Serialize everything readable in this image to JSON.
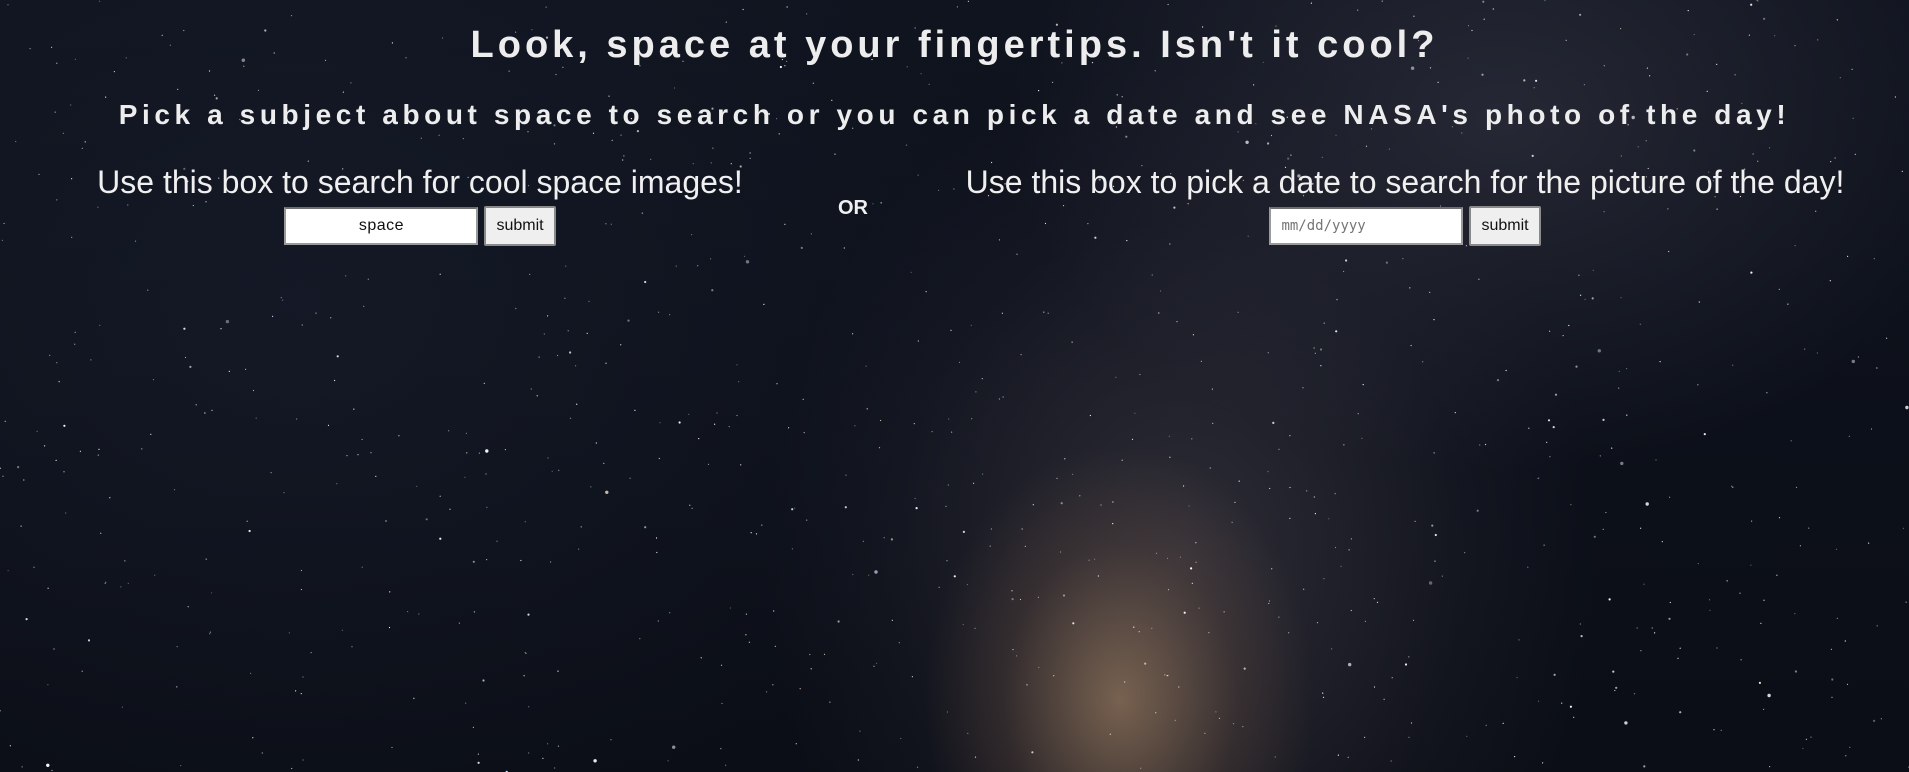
{
  "page": {
    "title": "Look, space at your fingertips. Isn't it cool?",
    "subtitle": "Pick a subject about space to search or you can pick a date and see NASA's photo of the day!"
  },
  "search_panel": {
    "label": "Use this box to search for cool space images!",
    "input_value": "space",
    "submit_label": "submit"
  },
  "separator": {
    "text": "OR"
  },
  "date_panel": {
    "label": "Use this box to pick a date to search for the picture of the day!",
    "input_placeholder": "mm/dd/yyyy",
    "submit_label": "submit"
  },
  "colors": {
    "text": "#f2f2f2",
    "background": "#0d111b",
    "milky_way_core": "#be966e",
    "button_bg": "#efefef"
  }
}
